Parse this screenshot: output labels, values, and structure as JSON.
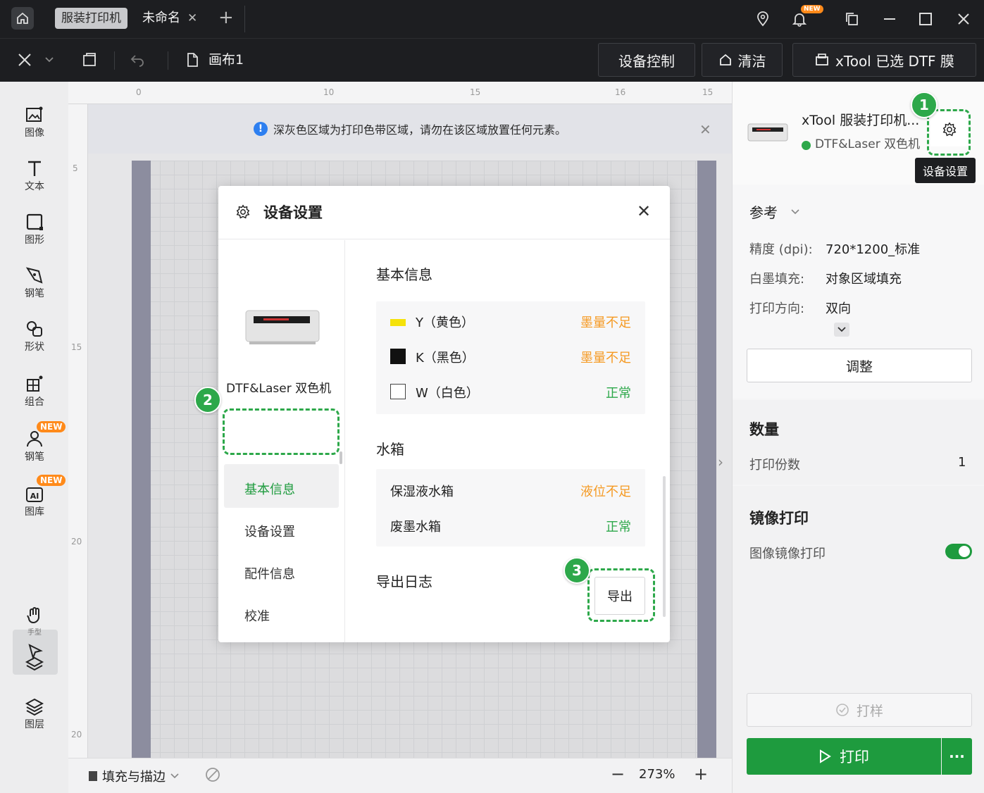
{
  "titlebar": {
    "active_tab": "服装打印机",
    "doc_tab": "未命名",
    "new_badge": "NEW"
  },
  "toolbar": {
    "canvas_name": "画布1",
    "device_control": "设备控制",
    "clean": "清洁",
    "selected_device": "xTool 已选 DTF 膜"
  },
  "leftbar": {
    "items": [
      "图像",
      "文本",
      "图形",
      "钢笔",
      "形状",
      "组合",
      "钢笔",
      "图库",
      "手型",
      "图层"
    ],
    "new_badge": "NEW"
  },
  "canvas": {
    "ruler_top": [
      "0",
      "10",
      "15",
      "16",
      "15"
    ],
    "ruler_left": [
      "5",
      "15",
      "20",
      "20"
    ],
    "notice": "深灰色区域为打印色带区域，请勿在该区域放置任何元素。"
  },
  "bottombar": {
    "fill_stroke": "填充与描边",
    "zoom": "273%"
  },
  "rightpanel": {
    "device_name": "xTool 服装打印机...",
    "device_model": "DTF&Laser 双色机",
    "tooltip": "设备设置",
    "reference_label": "参考",
    "precision_label": "精度 (dpi):",
    "precision_value": "720*1200_标准",
    "white_fill_label": "白墨填充:",
    "white_fill_value": "对象区域填充",
    "direction_label": "打印方向:",
    "direction_value": "双向",
    "adjust_button": "调整",
    "quantity_heading": "数量",
    "copies_label": "打印份数",
    "copies_value": "1",
    "mirror_heading": "镜像打印",
    "mirror_label": "图像镜像打印",
    "mirror_on": true,
    "sample_button": "打样",
    "print_button": "打印",
    "more_button": "···",
    "accent_color": "#1e9b3e"
  },
  "modal": {
    "title": "设备设置",
    "device_model": "DTF&Laser 双色机",
    "nav": [
      "基本信息",
      "设备设置",
      "配件信息",
      "校准"
    ],
    "basic_info_title": "基本信息",
    "inks": [
      {
        "name": "Y（黄色）",
        "status": "墨量不足",
        "level": "warn",
        "color": "#f5e20a"
      },
      {
        "name": "K（黑色）",
        "status": "墨量不足",
        "level": "warn",
        "color": "#111111"
      },
      {
        "name": "W（白色）",
        "status": "正常",
        "level": "ok",
        "color": "#ffffff"
      }
    ],
    "tank_title": "水箱",
    "tanks": [
      {
        "name": "保湿液水箱",
        "status": "液位不足",
        "level": "warn"
      },
      {
        "name": "废墨水箱",
        "status": "正常",
        "level": "ok"
      }
    ],
    "log_title": "导出日志",
    "export_button": "导出"
  },
  "steps": [
    "1",
    "2",
    "3"
  ]
}
